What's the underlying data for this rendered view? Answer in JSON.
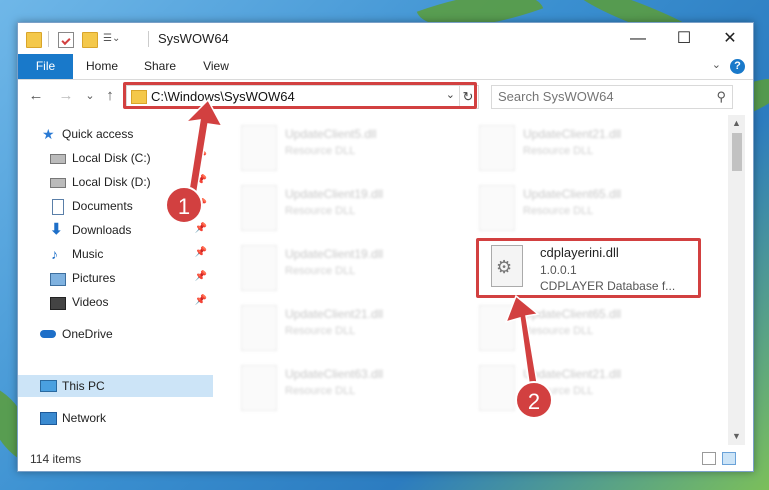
{
  "window": {
    "title": "SysWOW64",
    "minimize_glyph": "—",
    "maximize_glyph": "☐",
    "close_glyph": "✕"
  },
  "ribbon": {
    "tabs": [
      "File",
      "Home",
      "Share",
      "View"
    ],
    "help_glyph": "?",
    "expand_glyph": "⌄"
  },
  "address": {
    "path": "C:\\Windows\\SysWOW64",
    "search_placeholder": "Search SysWOW64",
    "back_glyph": "←",
    "forward_glyph": "→",
    "recent_glyph": "⌄",
    "up_glyph": "↑",
    "dropdown_glyph": "⌄",
    "refresh_glyph": "↻",
    "search_glyph": "⚲"
  },
  "nav": {
    "items": [
      {
        "label": "Quick access",
        "icon": "star-icon"
      },
      {
        "label": "Local Disk (C:)",
        "icon": "drive-icon",
        "pinned": true
      },
      {
        "label": "Local Disk (D:)",
        "icon": "drive-icon",
        "pinned": true
      },
      {
        "label": "Documents",
        "icon": "documents-icon",
        "pinned": true
      },
      {
        "label": "Downloads",
        "icon": "download-icon",
        "pinned": true
      },
      {
        "label": "Music",
        "icon": "music-icon",
        "pinned": true
      },
      {
        "label": "Pictures",
        "icon": "pictures-icon",
        "pinned": true
      },
      {
        "label": "Videos",
        "icon": "videos-icon",
        "pinned": true
      },
      {
        "label": "OneDrive",
        "icon": "cloud-icon"
      },
      {
        "label": "This PC",
        "icon": "computer-icon",
        "selected": true
      },
      {
        "label": "Network",
        "icon": "network-icon"
      }
    ],
    "pin_glyph": "📌"
  },
  "files": {
    "left": [
      {
        "name": "UpdateClient5.dll",
        "desc": "Resource DLL"
      },
      {
        "name": "UpdateClient19.dll",
        "desc": "Resource DLL"
      },
      {
        "name": "UpdateClient19.dll",
        "desc": "Resource DLL"
      },
      {
        "name": "UpdateClient21.dll",
        "desc": "Resource DLL"
      },
      {
        "name": "UpdateClient63.dll",
        "desc": "Resource DLL"
      }
    ],
    "right": [
      {
        "name": "UpdateClient21.dll",
        "desc": "Resource DLL"
      },
      {
        "name": "UpdateClient65.dll",
        "desc": "Resource DLL"
      },
      {
        "name": "UpdateClient65.dll",
        "desc": "Resource DLL"
      },
      {
        "name": "UpdateClient21.dll",
        "desc": "Resource DLL"
      }
    ],
    "selected": {
      "name": "cdplayerini.dll",
      "version": "1.0.0.1",
      "desc": "CDPLAYER Database f..."
    }
  },
  "status": {
    "item_count": "114 items"
  },
  "callouts": {
    "one": "1",
    "two": "2"
  },
  "colors": {
    "accent": "#1979ca",
    "highlight": "#d24040",
    "selected_nav": "#cce4f7"
  }
}
